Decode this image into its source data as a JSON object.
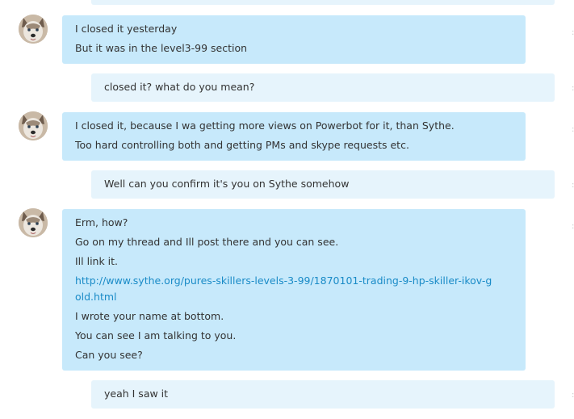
{
  "conversation": [
    {
      "direction": "incoming",
      "lines": [
        "I closed it yesterday",
        "But it was in the level3-99 section"
      ]
    },
    {
      "direction": "outgoing",
      "lines": [
        "closed it? what do you mean?"
      ]
    },
    {
      "direction": "incoming",
      "lines": [
        "I closed it, because I wa getting more views on Powerbot for it, than Sythe.",
        "Too hard controlling both and getting PMs and skype requests etc."
      ]
    },
    {
      "direction": "outgoing",
      "lines": [
        "Well can you confirm it's you on Sythe somehow"
      ]
    },
    {
      "direction": "incoming",
      "lines": [
        "Erm, how?",
        "Go on my thread and Ill post there and you can see.",
        "Ill link it.",
        "I wrote your name at bottom.",
        "You can see I am talking to you.",
        "Can you see?"
      ],
      "link": "http://www.sythe.org/pures-skillers-levels-3-99/1870101-trading-9-hp-skiller-ikov-gold.html"
    },
    {
      "direction": "outgoing",
      "lines": [
        "yeah I saw it"
      ]
    }
  ],
  "colors": {
    "incoming_bubble": "#c7e9fb",
    "outgoing_bubble": "#e6f4fc",
    "link": "#1a8bc7",
    "text": "#333333"
  },
  "icons": {
    "avatar": "husky-dog-avatar"
  }
}
